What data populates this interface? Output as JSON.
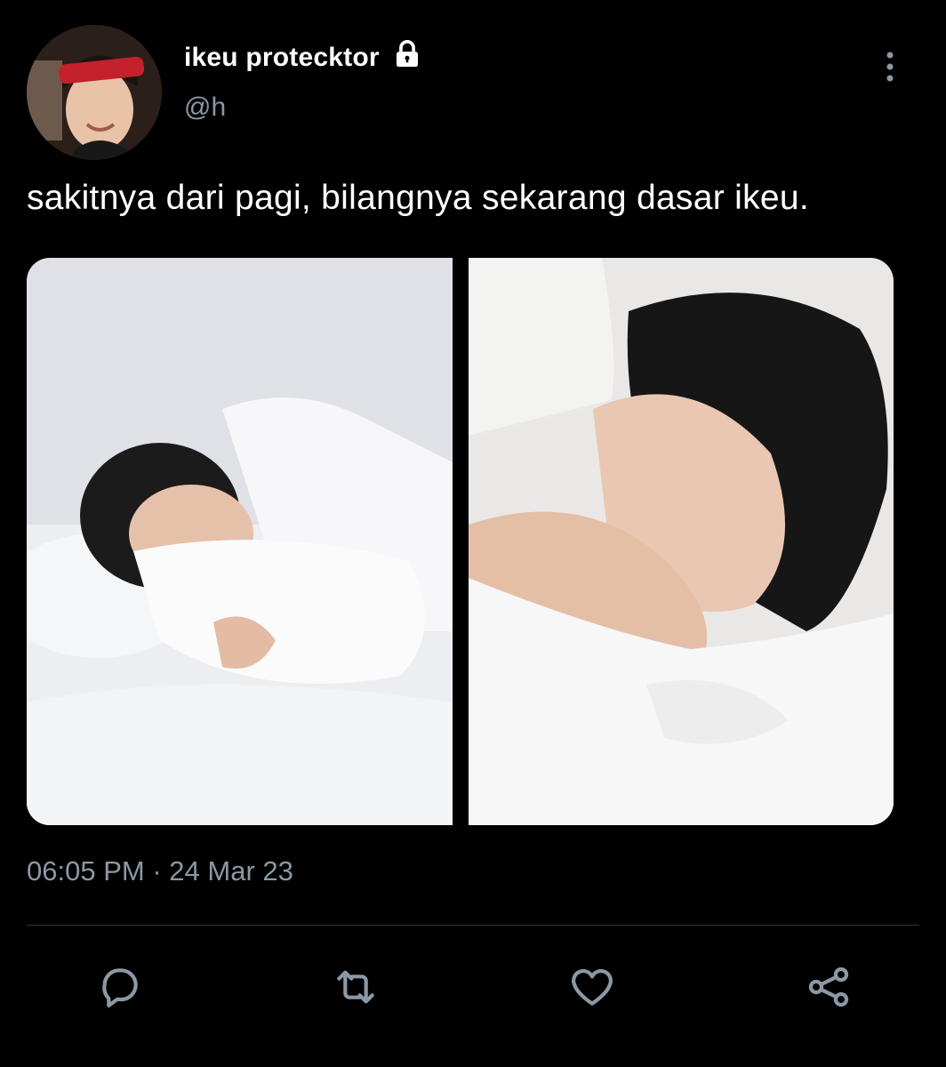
{
  "tweet": {
    "display_name": "ikeu protecktor",
    "handle": "@h",
    "protected_icon": "lock-icon",
    "text": "sakitnya dari pagi, bilangnya sekarang dasar ikeu.",
    "time": "06:05 PM",
    "separator": "·",
    "date": "24 Mar 23"
  },
  "media": [
    {
      "icon": "photo-sleeping-boy-1"
    },
    {
      "icon": "photo-sleeping-boy-2"
    }
  ],
  "actions": [
    {
      "icon": "reply-icon"
    },
    {
      "icon": "retweet-icon"
    },
    {
      "icon": "like-icon"
    },
    {
      "icon": "share-icon"
    }
  ],
  "colors": {
    "background": "#000000",
    "primary_text": "#ffffff",
    "secondary_text": "#8b98a5",
    "divider": "#2f3336"
  }
}
